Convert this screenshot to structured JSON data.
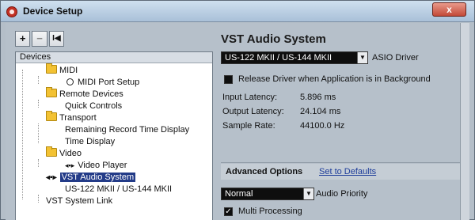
{
  "window": {
    "title": "Device Setup",
    "close_label": "x"
  },
  "toolbar": {
    "add_label": "+",
    "remove_label": "−",
    "reset_label": "I◀"
  },
  "tree": {
    "header": "Devices",
    "items": [
      {
        "label": "MIDI",
        "icon": "folder-icon"
      },
      {
        "label": "MIDI Port Setup",
        "icon": "circle-icon"
      },
      {
        "label": "Remote Devices",
        "icon": "folder-icon"
      },
      {
        "label": "Quick Controls",
        "icon": ""
      },
      {
        "label": "Transport",
        "icon": "folder-icon"
      },
      {
        "label": "Remaining Record Time Display",
        "icon": ""
      },
      {
        "label": "Time Display",
        "icon": ""
      },
      {
        "label": "Video",
        "icon": "folder-icon"
      },
      {
        "label": "Video Player",
        "icon": "speaker-icon"
      },
      {
        "label": "VST Audio System",
        "icon": "vst-icon",
        "selected": true
      },
      {
        "label": "US-122 MKII / US-144 MKII",
        "icon": ""
      },
      {
        "label": "VST System Link",
        "icon": ""
      }
    ]
  },
  "panel": {
    "title": "VST Audio System",
    "driver_value": "US-122 MKII / US-144 MKII",
    "driver_label": "ASIO Driver",
    "release_label": "Release Driver when Application is in Background",
    "release_checked": false,
    "input_latency_label": "Input Latency:",
    "input_latency_value": "5.896 ms",
    "output_latency_label": "Output Latency:",
    "output_latency_value": "24.104 ms",
    "sample_rate_label": "Sample Rate:",
    "sample_rate_value": "44100.0 Hz",
    "advanced_title": "Advanced Options",
    "set_defaults_label": "Set to Defaults",
    "priority_value": "Normal",
    "priority_label": "Audio Priority",
    "multi_processing_label": "Multi Processing",
    "multi_processing_checked": true,
    "checkmark": "✓",
    "dropdown_arrow": "▼"
  }
}
